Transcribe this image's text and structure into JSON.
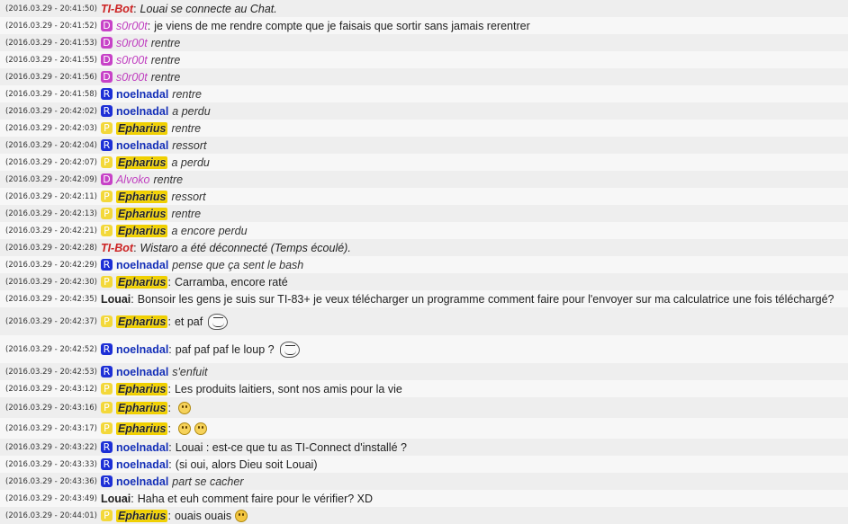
{
  "colors": {
    "R": "#1d2fd6",
    "D": "#c742c7",
    "P": "#f3d83a"
  },
  "messages": [
    {
      "ts": "(2016.03.29 - 20:41:50)",
      "badge": "",
      "user": "TI-Bot",
      "style": "bot",
      "sep": ":",
      "text": "Louai se connecte au Chat.",
      "action": true
    },
    {
      "ts": "(2016.03.29 - 20:41:52)",
      "badge": "D",
      "user": "s0r00t",
      "style": "D",
      "sep": ":",
      "text": "je viens de me rendre compte que je faisais que sortir sans jamais rerentrer",
      "action": false
    },
    {
      "ts": "(2016.03.29 - 20:41:53)",
      "badge": "D",
      "user": "s0r00t",
      "style": "D",
      "sep": "",
      "text": "rentre",
      "action": true
    },
    {
      "ts": "(2016.03.29 - 20:41:55)",
      "badge": "D",
      "user": "s0r00t",
      "style": "D",
      "sep": "",
      "text": "rentre",
      "action": true
    },
    {
      "ts": "(2016.03.29 - 20:41:56)",
      "badge": "D",
      "user": "s0r00t",
      "style": "D",
      "sep": "",
      "text": "rentre",
      "action": true
    },
    {
      "ts": "(2016.03.29 - 20:41:58)",
      "badge": "R",
      "user": "noelnadal",
      "style": "R",
      "sep": "",
      "text": "rentre",
      "action": true
    },
    {
      "ts": "(2016.03.29 - 20:42:02)",
      "badge": "R",
      "user": "noelnadal",
      "style": "R",
      "sep": "",
      "text": "a perdu",
      "action": true
    },
    {
      "ts": "(2016.03.29 - 20:42:03)",
      "badge": "P",
      "user": "Epharius",
      "style": "P",
      "sep": "",
      "text": "rentre",
      "action": true
    },
    {
      "ts": "(2016.03.29 - 20:42:04)",
      "badge": "R",
      "user": "noelnadal",
      "style": "R",
      "sep": "",
      "text": "ressort",
      "action": true
    },
    {
      "ts": "(2016.03.29 - 20:42:07)",
      "badge": "P",
      "user": "Epharius",
      "style": "P",
      "sep": "",
      "text": "a perdu",
      "action": true
    },
    {
      "ts": "(2016.03.29 - 20:42:09)",
      "badge": "D",
      "user": "Alvoko",
      "style": "D",
      "sep": "",
      "text": "rentre",
      "action": true
    },
    {
      "ts": "(2016.03.29 - 20:42:11)",
      "badge": "P",
      "user": "Epharius",
      "style": "P",
      "sep": "",
      "text": "ressort",
      "action": true
    },
    {
      "ts": "(2016.03.29 - 20:42:13)",
      "badge": "P",
      "user": "Epharius",
      "style": "P",
      "sep": "",
      "text": "rentre",
      "action": true
    },
    {
      "ts": "(2016.03.29 - 20:42:21)",
      "badge": "P",
      "user": "Epharius",
      "style": "P",
      "sep": "",
      "text": "a encore perdu",
      "action": true
    },
    {
      "ts": "(2016.03.29 - 20:42:28)",
      "badge": "",
      "user": "TI-Bot",
      "style": "bot",
      "sep": ":",
      "text": "Wistaro a été déconnecté (Temps écoulé).",
      "action": true
    },
    {
      "ts": "(2016.03.29 - 20:42:29)",
      "badge": "R",
      "user": "noelnadal",
      "style": "R",
      "sep": "",
      "text": "pense que ça sent le bash",
      "action": true
    },
    {
      "ts": "(2016.03.29 - 20:42:30)",
      "badge": "P",
      "user": "Epharius",
      "style": "P",
      "sep": ":",
      "text": "Carramba, encore raté",
      "action": false
    },
    {
      "ts": "(2016.03.29 - 20:42:35)",
      "badge": "",
      "user": "Louai",
      "style": "plain",
      "sep": ":",
      "text": "Bonsoir les gens je suis sur TI-83+ je veux télécharger un programme comment faire pour l'envoyer sur ma calculatrice une fois téléchargé?",
      "action": false
    },
    {
      "ts": "(2016.03.29 - 20:42:37)",
      "badge": "P",
      "user": "Epharius",
      "style": "P",
      "sep": ":",
      "text": "et paf",
      "action": false,
      "emoji": [
        "troll"
      ],
      "size": "tall"
    },
    {
      "ts": "(2016.03.29 - 20:42:52)",
      "badge": "R",
      "user": "noelnadal",
      "style": "R",
      "sep": ":",
      "text": "paf paf paf le loup ?",
      "action": false,
      "emoji": [
        "troll"
      ],
      "size": "tall"
    },
    {
      "ts": "(2016.03.29 - 20:42:53)",
      "badge": "R",
      "user": "noelnadal",
      "style": "R",
      "sep": "",
      "text": "s'enfuit",
      "action": true
    },
    {
      "ts": "(2016.03.29 - 20:43:12)",
      "badge": "P",
      "user": "Epharius",
      "style": "P",
      "sep": ":",
      "text": "Les produits laitiers, sont nos amis pour la vie",
      "action": false
    },
    {
      "ts": "(2016.03.29 - 20:43:16)",
      "badge": "P",
      "user": "Epharius",
      "style": "P",
      "sep": ":",
      "text": "",
      "action": false,
      "emoji": [
        "smile"
      ],
      "size": "mid"
    },
    {
      "ts": "(2016.03.29 - 20:43:17)",
      "badge": "P",
      "user": "Epharius",
      "style": "P",
      "sep": ":",
      "text": "",
      "action": false,
      "emoji": [
        "smile",
        "smile"
      ],
      "size": "mid"
    },
    {
      "ts": "(2016.03.29 - 20:43:22)",
      "badge": "R",
      "user": "noelnadal",
      "style": "R",
      "sep": ":",
      "text": "Louai : est-ce que tu as TI-Connect d'installé ?",
      "action": false
    },
    {
      "ts": "(2016.03.29 - 20:43:33)",
      "badge": "R",
      "user": "noelnadal",
      "style": "R",
      "sep": ":",
      "text": "(si oui, alors Dieu soit Louai)",
      "action": false
    },
    {
      "ts": "(2016.03.29 - 20:43:36)",
      "badge": "R",
      "user": "noelnadal",
      "style": "R",
      "sep": "",
      "text": "part se cacher",
      "action": true
    },
    {
      "ts": "(2016.03.29 - 20:43:49)",
      "badge": "",
      "user": "Louai",
      "style": "plain",
      "sep": ":",
      "text": "Haha et euh comment faire pour le vérifier? XD",
      "action": false
    },
    {
      "ts": "(2016.03.29 - 20:44:01)",
      "badge": "P",
      "user": "Epharius",
      "style": "P",
      "sep": ":",
      "text": "ouais ouais",
      "action": false,
      "emoji": [
        "tongue"
      ]
    }
  ]
}
